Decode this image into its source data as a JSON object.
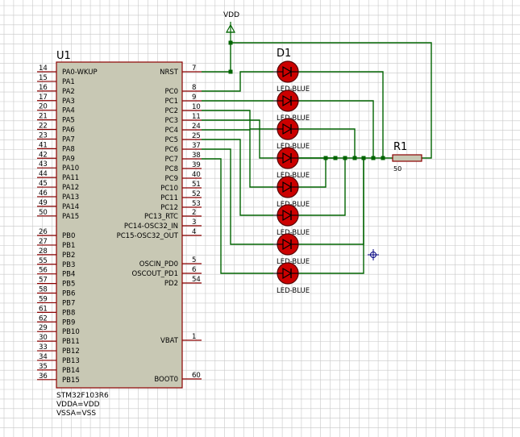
{
  "colors": {
    "background": "#ffffff",
    "grid": "#c8c8c8",
    "chip_fill": "#c8c8b4",
    "chip_border": "#8b0000",
    "pin_line": "#8b0000",
    "wire": "#006400",
    "led_body": "#cc0000",
    "text": "#000000",
    "junction": "#006400",
    "cursor": "#000080"
  },
  "power": {
    "label": "VDD"
  },
  "chip": {
    "ref": "U1",
    "part": "STM32F103R6",
    "props": [
      "VDDA=VDD",
      "VSSA=VSS"
    ],
    "left_pins": [
      {
        "num": "14",
        "name": "PA0-WKUP"
      },
      {
        "num": "15",
        "name": "PA1"
      },
      {
        "num": "16",
        "name": "PA2"
      },
      {
        "num": "17",
        "name": "PA3"
      },
      {
        "num": "20",
        "name": "PA4"
      },
      {
        "num": "21",
        "name": "PA5"
      },
      {
        "num": "22",
        "name": "PA6"
      },
      {
        "num": "23",
        "name": "PA7"
      },
      {
        "num": "41",
        "name": "PA8"
      },
      {
        "num": "42",
        "name": "PA9"
      },
      {
        "num": "43",
        "name": "PA10"
      },
      {
        "num": "44",
        "name": "PA11"
      },
      {
        "num": "45",
        "name": "PA12"
      },
      {
        "num": "46",
        "name": "PA13"
      },
      {
        "num": "49",
        "name": "PA14"
      },
      {
        "num": "50",
        "name": "PA15"
      },
      {
        "num": "26",
        "name": "PB0"
      },
      {
        "num": "27",
        "name": "PB1"
      },
      {
        "num": "28",
        "name": "PB2"
      },
      {
        "num": "55",
        "name": "PB3"
      },
      {
        "num": "56",
        "name": "PB4"
      },
      {
        "num": "57",
        "name": "PB5"
      },
      {
        "num": "58",
        "name": "PB6"
      },
      {
        "num": "59",
        "name": "PB7"
      },
      {
        "num": "61",
        "name": "PB8"
      },
      {
        "num": "62",
        "name": "PB9"
      },
      {
        "num": "29",
        "name": "PB10"
      },
      {
        "num": "30",
        "name": "PB11"
      },
      {
        "num": "33",
        "name": "PB12"
      },
      {
        "num": "34",
        "name": "PB13"
      },
      {
        "num": "35",
        "name": "PB14"
      },
      {
        "num": "36",
        "name": "PB15"
      }
    ],
    "right_pins": [
      {
        "num": "7",
        "name": "NRST"
      },
      {
        "num": "8",
        "name": "PC0"
      },
      {
        "num": "9",
        "name": "PC1"
      },
      {
        "num": "10",
        "name": "PC2"
      },
      {
        "num": "11",
        "name": "PC3"
      },
      {
        "num": "24",
        "name": "PC4"
      },
      {
        "num": "25",
        "name": "PC5"
      },
      {
        "num": "37",
        "name": "PC6"
      },
      {
        "num": "38",
        "name": "PC7"
      },
      {
        "num": "39",
        "name": "PC8"
      },
      {
        "num": "40",
        "name": "PC9"
      },
      {
        "num": "51",
        "name": "PC10"
      },
      {
        "num": "52",
        "name": "PC11"
      },
      {
        "num": "53",
        "name": "PC12"
      },
      {
        "num": "2",
        "name": "PC13_RTC"
      },
      {
        "num": "3",
        "name": "PC14-OSC32_IN"
      },
      {
        "num": "4",
        "name": "PC15-OSC32_OUT"
      },
      {
        "num": "5",
        "name": "OSCIN_PD0"
      },
      {
        "num": "6",
        "name": "OSCOUT_PD1"
      },
      {
        "num": "54",
        "name": "PD2"
      },
      {
        "num": "1",
        "name": "VBAT"
      },
      {
        "num": "60",
        "name": "BOOT0"
      }
    ]
  },
  "leds": {
    "ref": "D1",
    "items": [
      {
        "label": "LED-BLUE"
      },
      {
        "label": "LED-BLUE"
      },
      {
        "label": "LED-BLUE"
      },
      {
        "label": "LED-BLUE"
      },
      {
        "label": "LED-BLUE"
      },
      {
        "label": "LED-BLUE"
      },
      {
        "label": "LED-BLUE"
      },
      {
        "label": "LED-BLUE"
      }
    ]
  },
  "resistor": {
    "ref": "R1",
    "value": "50"
  }
}
